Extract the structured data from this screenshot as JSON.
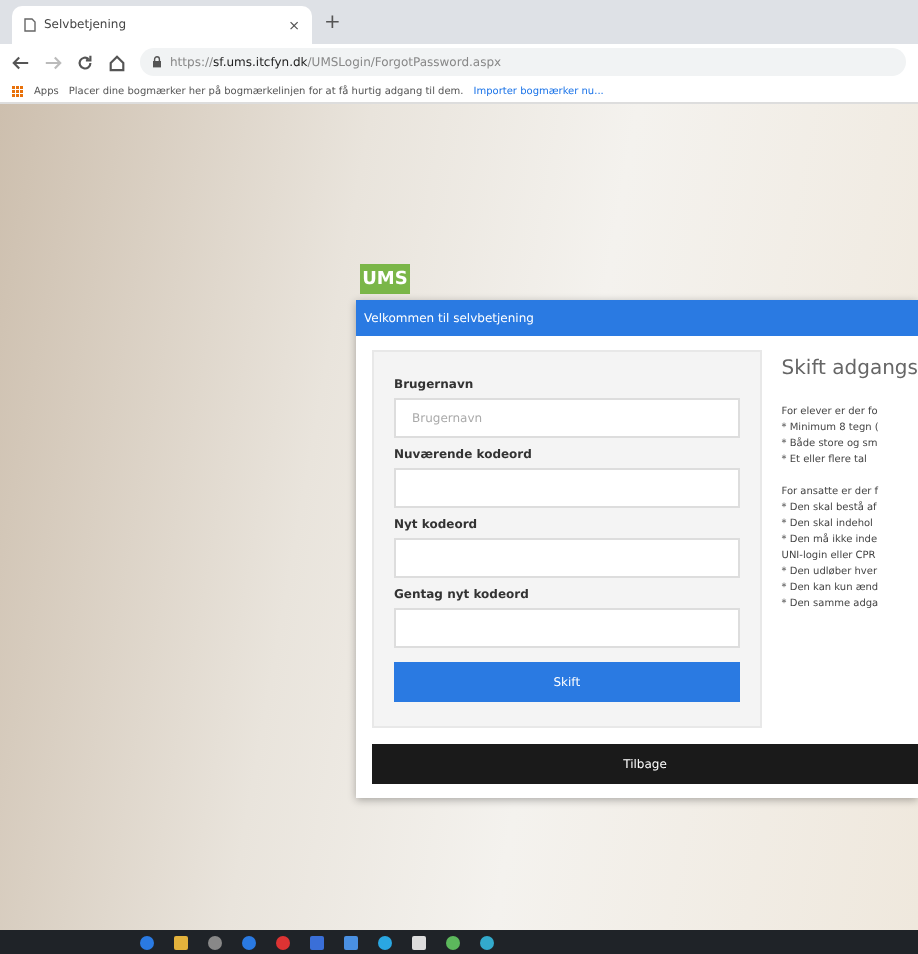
{
  "browser": {
    "tab": {
      "title": "Selvbetjening",
      "close": "×"
    },
    "new_tab": "+",
    "url": "https://**sf.ums.itcfyn.dk**/UMSLogin/ForgotPassword.aspx",
    "bookmarks": {
      "apps": "Apps",
      "message": "Placer dine bogmærker her på bogmærkelinjen for at få hurtig adgang til dem.",
      "import_link": "Importer bogmærker nu..."
    }
  },
  "page": {
    "logo": "UMS",
    "dialog_title": "Velkommen til selvbetjening",
    "fields": [
      {
        "label": "Brugernavn",
        "placeholder": "Brugernavn"
      },
      {
        "label": "Nuværende kodeord"
      },
      {
        "label": "Nyt kodeord"
      },
      {
        "label": "Gentag nyt kodeord"
      }
    ],
    "submit": "Skift",
    "info": {
      "title": "Skift adgangs",
      "paragraphs": [
        [
          "For elever er der fo",
          "* Minimum 8 tegn (",
          "* Både store og sm",
          "* Et eller flere tal"
        ],
        [
          "For ansatte er der f",
          "* Den skal bestå af",
          "* Den skal indehol",
          "* Den må ikke inde",
          "UNI-login eller CPR",
          "* Den udløber hver",
          "* Den kan kun ænd",
          "* Den samme adga"
        ]
      ]
    },
    "back": "Tilbage"
  }
}
